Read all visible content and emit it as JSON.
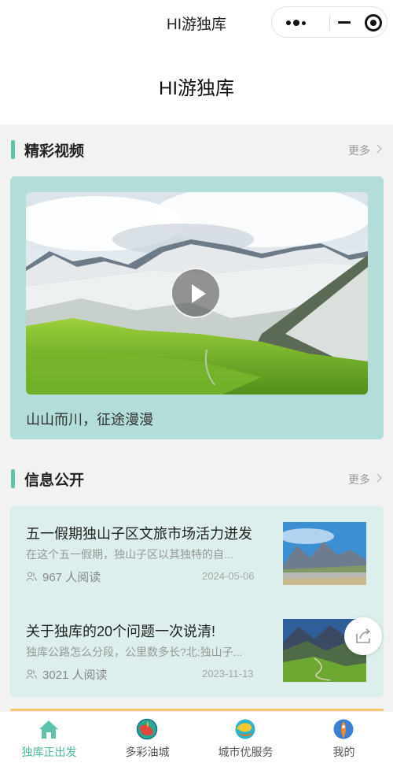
{
  "topbar": {
    "title": "HI游独库"
  },
  "page": {
    "title": "HI游独库"
  },
  "videos_section": {
    "title": "精彩视频",
    "more": "更多",
    "video": {
      "caption": "山山而川，征途漫漫"
    }
  },
  "info_section": {
    "title": "信息公开",
    "more": "更多",
    "items": [
      {
        "title": "五一假期独山子区文旅市场活力迸发",
        "summary": "在这个五一假期，独山子区以其独特的自...",
        "reads": "967 人阅读",
        "date": "2024-05-06"
      },
      {
        "title": "关于独库的20个问题一次说清!",
        "summary": "独库公路怎么分段，公里数多长?北:独山子...",
        "reads": "3021 人阅读",
        "date": "2023-11-13"
      }
    ]
  },
  "tabbar": {
    "items": [
      {
        "label": "独库正出发",
        "icon": "home-icon",
        "active": true
      },
      {
        "label": "多彩油城",
        "icon": "city-globe-icon",
        "active": false
      },
      {
        "label": "城市优服务",
        "icon": "service-globe-icon",
        "active": false
      },
      {
        "label": "我的",
        "icon": "profile-icon",
        "active": false
      }
    ]
  },
  "colors": {
    "accent": "#5fc3ac",
    "active_tab": "#4db89c",
    "video_card_bg": "#b2ddd8",
    "news_card_bg": "#dcefed"
  }
}
